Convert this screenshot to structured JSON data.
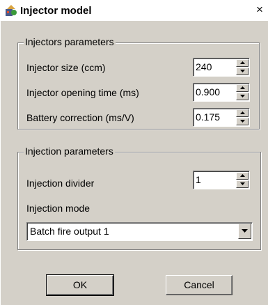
{
  "window": {
    "title": "Injector model",
    "close_symbol": "×"
  },
  "injectors": {
    "title": "Injectors parameters",
    "size": {
      "label": "Injector size (ccm)",
      "value": "240"
    },
    "opening": {
      "label": "Injector opening time (ms)",
      "value": "0.900"
    },
    "battery": {
      "label": "Battery correction  (ms/V)",
      "value": "0.175"
    }
  },
  "injection": {
    "title": "Injection parameters",
    "divider": {
      "label": "Injection divider",
      "value": "1"
    },
    "mode": {
      "label": "Injection mode",
      "selected": "Batch fire output 1"
    }
  },
  "buttons": {
    "ok": "OK",
    "cancel": "Cancel"
  }
}
